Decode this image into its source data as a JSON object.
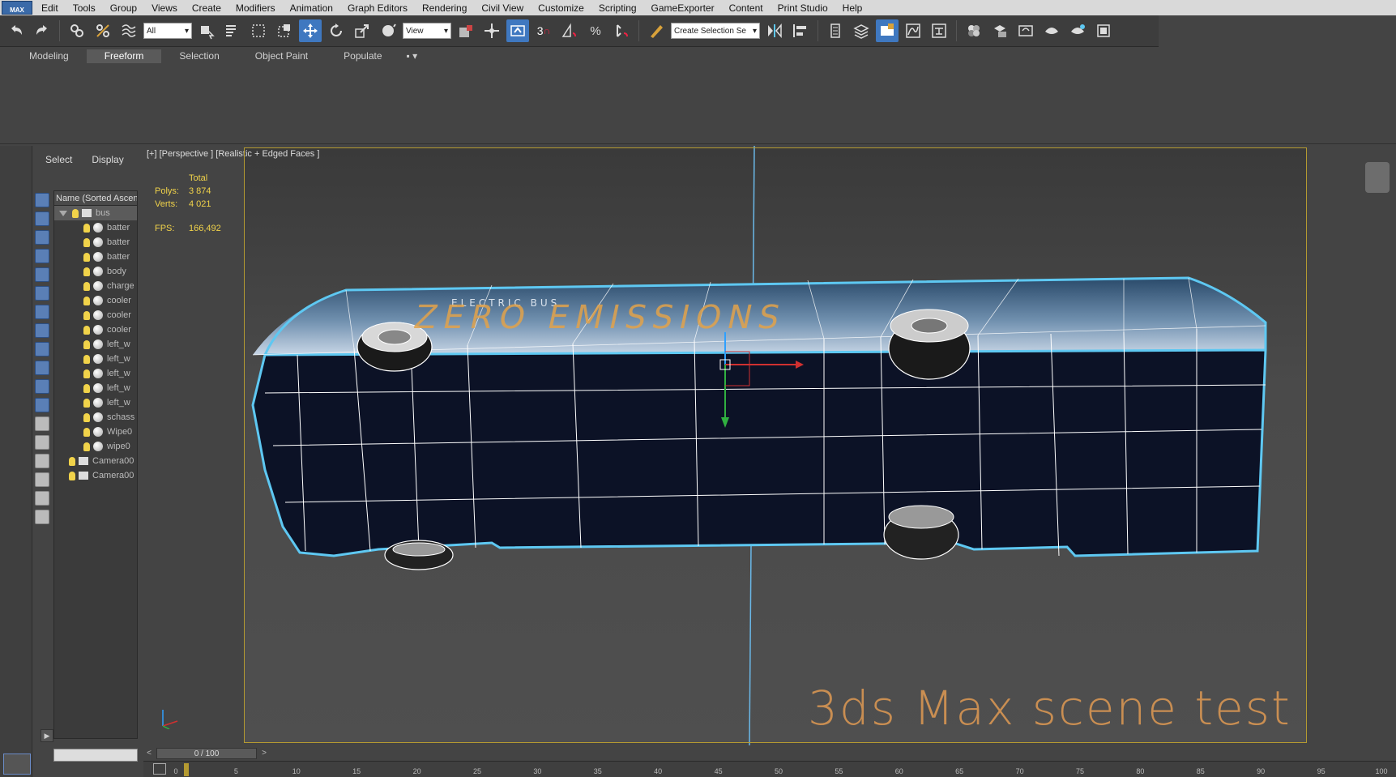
{
  "menu": {
    "logo": "MAX",
    "items": [
      "Edit",
      "Tools",
      "Group",
      "Views",
      "Create",
      "Modifiers",
      "Animation",
      "Graph Editors",
      "Rendering",
      "Civil View",
      "Customize",
      "Scripting",
      "GameExporter",
      "Content",
      "Print Studio",
      "Help"
    ]
  },
  "toolbar": {
    "selection_filter": "All",
    "ref_coord": "View",
    "named_selection_placeholder": "Create Selection Se",
    "snap_label": "3"
  },
  "ribbon": {
    "tabs": [
      "Modeling",
      "Freeform",
      "Selection",
      "Object Paint",
      "Populate"
    ],
    "active_tab": "Freeform"
  },
  "explorer": {
    "tabs": [
      "Select",
      "Display"
    ],
    "header": "Name (Sorted Ascending)",
    "root": "bus",
    "children": [
      "batter",
      "batter",
      "batter",
      "body",
      "charge",
      "cooler",
      "cooler",
      "cooler",
      "left_w",
      "left_w",
      "left_w",
      "left_w",
      "left_w",
      "schass",
      "Wipe0",
      "wipe0"
    ],
    "cameras": [
      "Camera00",
      "Camera00"
    ]
  },
  "viewport": {
    "label": "[+] [Perspective ] [Realistic + Edged Faces ]",
    "stats": {
      "header": "Total",
      "polys_label": "Polys:",
      "polys": "3 874",
      "verts_label": "Verts:",
      "verts": "4 021",
      "fps_label": "FPS:",
      "fps": "166,492"
    },
    "watermark": "3ds Max scene test",
    "bus_text": "ZERO EMISSIONS",
    "bus_small_text": "ELECTRIC BUS"
  },
  "timeline": {
    "slider": "0 / 100",
    "ticks": [
      "0",
      "5",
      "10",
      "15",
      "20",
      "25",
      "30",
      "35",
      "40",
      "45",
      "50",
      "55",
      "60",
      "65",
      "70",
      "75",
      "80",
      "85",
      "90",
      "95",
      "100"
    ]
  },
  "colors": {
    "accent": "#3f78c0",
    "viewport_border": "#b49a31",
    "stats": "#f1d34a",
    "watermark": "#c98e52",
    "wire": "#ffffff",
    "bus_outline": "#5ec8f2"
  }
}
